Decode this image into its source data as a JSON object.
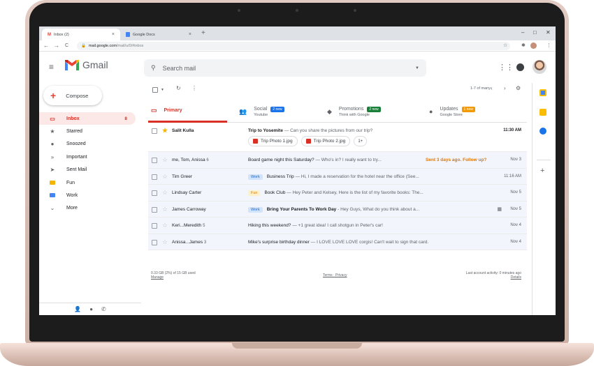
{
  "browser": {
    "tabs": [
      {
        "title": "Inbox (2)",
        "favicon": "gmail-favicon",
        "close": "×"
      },
      {
        "title": "Google Docs",
        "favicon": "docs-favicon",
        "close": "×"
      }
    ],
    "new_tab": "+",
    "window_controls": {
      "minimize": "–",
      "maximize": "□",
      "close": "✕"
    },
    "url_host": "mail.google.com",
    "url_path": "/mail/u/0/#inbox",
    "nav": {
      "back": "←",
      "forward": "→",
      "reload": "C"
    }
  },
  "header": {
    "app_name": "Gmail",
    "search_placeholder": "Search mail",
    "icons": [
      "apps-grid-icon",
      "notifications-icon",
      "account-avatar"
    ]
  },
  "sidebar": {
    "compose_label": "Compose",
    "items": [
      {
        "label": "Inbox",
        "count": "8",
        "icon": "inbox-icon",
        "active": true
      },
      {
        "label": "Starred",
        "icon": "star-icon"
      },
      {
        "label": "Snoozed",
        "icon": "clock-icon"
      },
      {
        "label": "Important",
        "icon": "important-icon"
      },
      {
        "label": "Sent Mail",
        "icon": "send-icon"
      },
      {
        "label": "Fun",
        "icon": "label-icon",
        "color": "#f4b400"
      },
      {
        "label": "Work",
        "icon": "label-icon",
        "color": "#4285f4"
      },
      {
        "label": "More",
        "icon": "chevron-down-icon"
      }
    ]
  },
  "toolbar": {
    "paging": "1-7 of many"
  },
  "categories": [
    {
      "name": "Primary",
      "sub": "",
      "badge": "",
      "badge_color": ""
    },
    {
      "name": "Social",
      "sub": "Youtube",
      "badge": "2 new",
      "badge_color": "#1a73e8"
    },
    {
      "name": "Promotions",
      "sub": "Think with Google",
      "badge": "2 new",
      "badge_color": "#188038"
    },
    {
      "name": "Updates",
      "sub": "Google Store",
      "badge": "1 new",
      "badge_color": "#f29900"
    }
  ],
  "emails": [
    {
      "sender": "Salit Kulla",
      "thread_count": "",
      "label": "",
      "subject": "Trip to Yosemite",
      "snippet": " — Can you share the pictures from our trip?",
      "followup": "",
      "date": "11:30 AM",
      "unread": true,
      "starred": true,
      "attachments": [
        "Trip Photo 1.jpg",
        "Trip Photo 2.jpg"
      ],
      "more_attachments": "1+"
    },
    {
      "sender": "me, Tom, Anissa",
      "thread_count": "6",
      "label": "",
      "subject": "Board game night this Saturday?",
      "snippet": " — Who's in? I really want to try...",
      "followup": "Sent 3 days ago. Follow up?",
      "date": "Nov 3",
      "unread": false
    },
    {
      "sender": "Tim Greer",
      "thread_count": "",
      "label": "Work",
      "subject": "Business Trip",
      "snippet": " — Hi, I made a reservation for the hotel near the office (See...",
      "followup": "",
      "date": "11:16 AM",
      "unread": false
    },
    {
      "sender": "Lindsay Carter",
      "thread_count": "",
      "label": "Fun",
      "subject": "Book Club",
      "snippet": " — Hey Peter and Kelsey, Here is the list of my favorite books: The...",
      "followup": "",
      "date": "Nov 5",
      "unread": false
    },
    {
      "sender": "James Carroway",
      "thread_count": "",
      "label": "Work",
      "subject": "Bring Your Parents To Work Day",
      "snippet": " - Hey Guys, What do you think about a...",
      "followup": "",
      "date": "Nov 5",
      "unread": false,
      "calendar": true
    },
    {
      "sender": "Keri...Meredith",
      "thread_count": "5",
      "label": "",
      "subject": "Hiking this weekend?",
      "snippet": " — +1 great idea! I call shotgun in Peter's car!",
      "followup": "",
      "date": "Nov 4",
      "unread": false
    },
    {
      "sender": "Anissa...James",
      "thread_count": "3",
      "label": "",
      "subject": "Mike's surprise birthday dinner",
      "snippet": " — I LOVE LOVE LOVE corgis! Can't wait to sign that card.",
      "followup": "",
      "date": "Nov 4",
      "unread": false
    }
  ],
  "footer": {
    "storage": "0.33 GB (2%) of 15 GB used",
    "manage": "Manage",
    "terms": "Terms · Privacy",
    "activity": "Last account activity: 0 minutes ago",
    "details": "Details"
  },
  "colors": {
    "accent": "#d93025",
    "work_label_bg": "#d2e3fc",
    "work_label_fg": "#1967d2",
    "fun_label_bg": "#fef0c7",
    "fun_label_fg": "#e37400"
  }
}
